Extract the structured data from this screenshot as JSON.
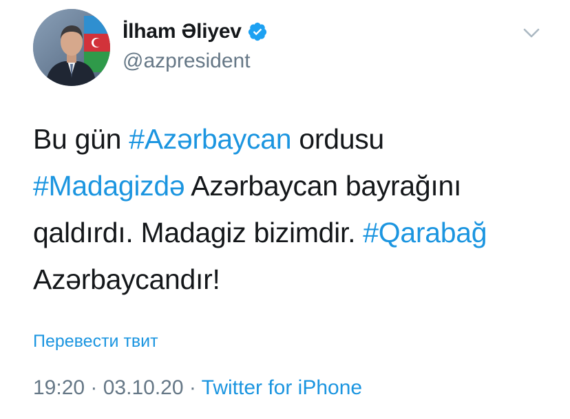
{
  "author": {
    "display_name": "İlham Əliyev",
    "handle": "@azpresident",
    "verified": true
  },
  "tweet": {
    "lines": [
      [
        {
          "text": "Bu gün ",
          "type": "plain"
        },
        {
          "text": "#Azərbaycan",
          "type": "hashtag"
        },
        {
          "text": " ordusu",
          "type": "plain"
        }
      ],
      [
        {
          "text": "#Madagizdə",
          "type": "hashtag"
        },
        {
          "text": " Azərbaycan bayrağını",
          "type": "plain"
        }
      ],
      [
        {
          "text": "qaldırdı. Madagiz bizimdir. ",
          "type": "plain"
        },
        {
          "text": "#Qarabağ",
          "type": "hashtag"
        }
      ],
      [
        {
          "text": "Azərbaycandır!",
          "type": "plain"
        }
      ]
    ]
  },
  "translate_label": "Перевести твит",
  "meta": {
    "time": "19:20",
    "separator": " · ",
    "date": "03.10.20",
    "source": "Twitter for iPhone"
  },
  "icons": {
    "verified": "verified-badge-icon",
    "caret": "chevron-down-icon"
  },
  "colors": {
    "link": "#1b95e0",
    "secondary_text": "#657786",
    "primary_text": "#14171a",
    "verified_badge": "#1da1f2"
  }
}
